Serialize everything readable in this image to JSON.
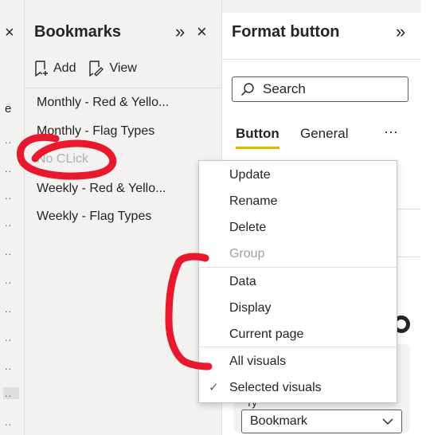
{
  "left_strip": {
    "close_glyph": "×",
    "partial_text": "e",
    "dots": [
      "..",
      "..",
      "..",
      "..",
      "..",
      "..",
      "..",
      "..",
      "..",
      "..",
      ".."
    ]
  },
  "bookmarks": {
    "title": "Bookmarks",
    "add_label": "Add",
    "view_label": "View",
    "items": [
      {
        "label": "Monthly - Red & Yello..."
      },
      {
        "label": "Monthly - Flag Types"
      },
      {
        "label": "No CLick"
      },
      {
        "label": "Weekly - Red & Yello..."
      },
      {
        "label": "Weekly - Flag Types"
      }
    ]
  },
  "format_pane": {
    "title": "Format button",
    "search_placeholder": "Search",
    "tabs": [
      "Button",
      "General"
    ],
    "more_glyph": "···",
    "type_label": "Ty",
    "type_value": "Bookmark"
  },
  "context_menu": {
    "items": [
      {
        "label": "Update",
        "enabled": true,
        "checked": false
      },
      {
        "label": "Rename",
        "enabled": true,
        "checked": false
      },
      {
        "label": "Delete",
        "enabled": true,
        "checked": false
      },
      {
        "label": "Group",
        "enabled": false,
        "checked": false
      },
      {
        "label": "Data",
        "enabled": true,
        "checked": false
      },
      {
        "label": "Display",
        "enabled": true,
        "checked": false
      },
      {
        "label": "Current page",
        "enabled": true,
        "checked": false
      },
      {
        "label": "All visuals",
        "enabled": true,
        "checked": false
      },
      {
        "label": "Selected visuals",
        "enabled": true,
        "checked": true
      }
    ],
    "check_glyph": "✓"
  },
  "colors": {
    "pane_bg": "#f3f2f1",
    "accent_underline": "#e8b400",
    "annotation_red": "#e8192c"
  }
}
